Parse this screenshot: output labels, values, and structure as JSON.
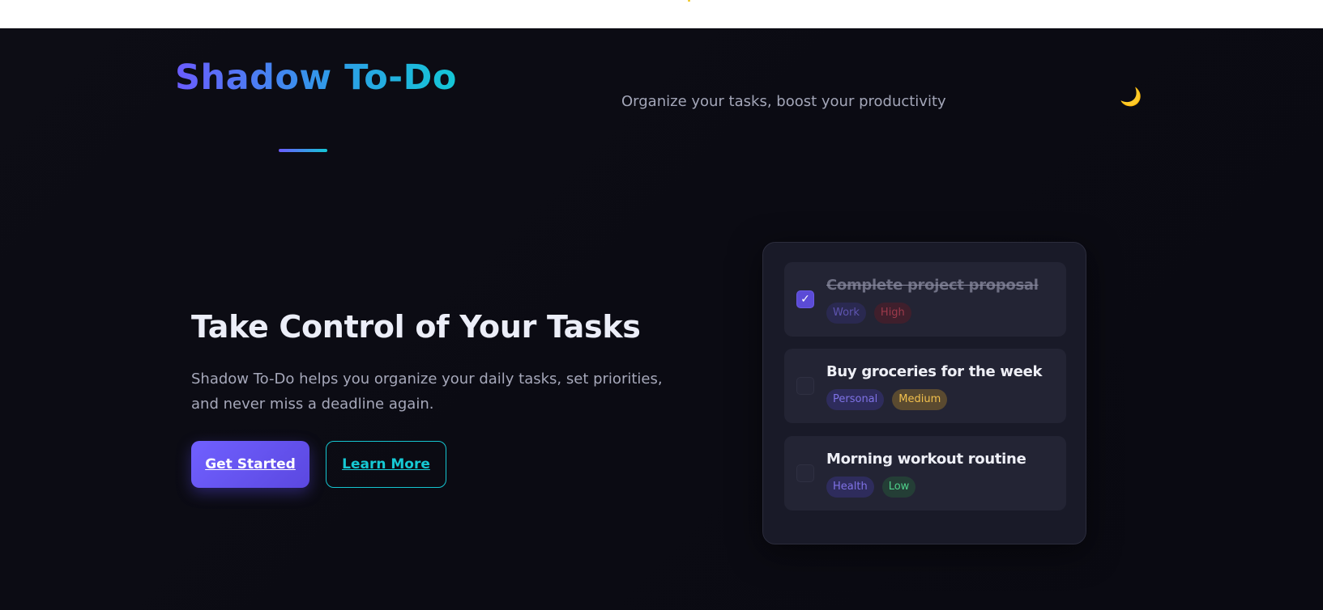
{
  "app": {
    "title": "Shadow To-Do",
    "tagline": "Organize your tasks, boost your productivity",
    "theme_icon": "moon-icon",
    "theme_glyph": "🌙"
  },
  "hero": {
    "title": "Take Control of Your Tasks",
    "description": "Shadow To-Do helps you organize your daily tasks, set priorities, and never miss a deadline again.",
    "primary_button": "Get Started",
    "secondary_button": "Learn More"
  },
  "tasks": [
    {
      "title": "Complete project proposal",
      "completed": true,
      "category": "Work",
      "priority": "High"
    },
    {
      "title": "Buy groceries for the week",
      "completed": false,
      "category": "Personal",
      "priority": "Medium"
    },
    {
      "title": "Morning workout routine",
      "completed": false,
      "category": "Health",
      "priority": "Low"
    }
  ],
  "check_glyph": "✓",
  "colors": {
    "accent": "#6b5cff",
    "accent_secondary": "#14c7d6",
    "background": "#0c0c14",
    "priority_high": "#d34b60",
    "priority_medium": "#f2c04d",
    "priority_low": "#4fd08a"
  }
}
